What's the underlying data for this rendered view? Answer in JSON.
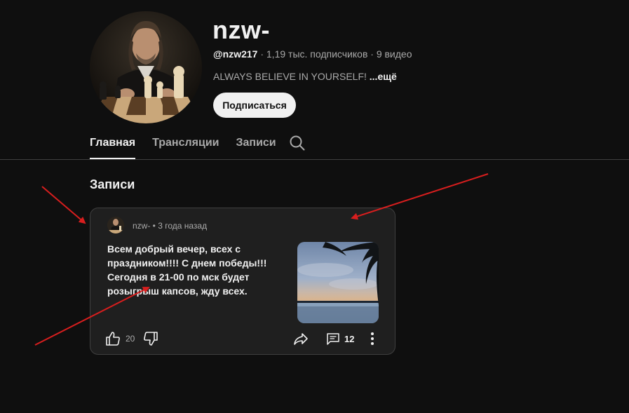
{
  "channel": {
    "name": "nzw-",
    "handle": "@nzw217",
    "subscribers": " · 1,19 тыс. подписчиков · 9 видео",
    "description": "ALWAYS BELIEVE IN YOURSELF! ",
    "more_label": "...ещё",
    "subscribe_label": "Подписаться"
  },
  "tabs": [
    {
      "label": "Главная",
      "active": true
    },
    {
      "label": "Трансляции",
      "active": false
    },
    {
      "label": "Записи",
      "active": false
    }
  ],
  "section": {
    "title": "Записи"
  },
  "post": {
    "author": "nzw-",
    "time": " • 3 года назад",
    "text": "Всем добрый вечер, всех с праздником!!!! С днем победы!!! Сегодня в 21-00 по мск будет розыгрыш капсов, жду всех.",
    "likes": "20",
    "comments": "12"
  },
  "colors": {
    "background": "#0f0f0f",
    "card": "#1f1f1f",
    "annotation_arrows": "#d81e1e"
  },
  "icons": [
    "search-icon",
    "like-icon",
    "dislike-icon",
    "share-icon",
    "comment-icon",
    "more-icon"
  ]
}
